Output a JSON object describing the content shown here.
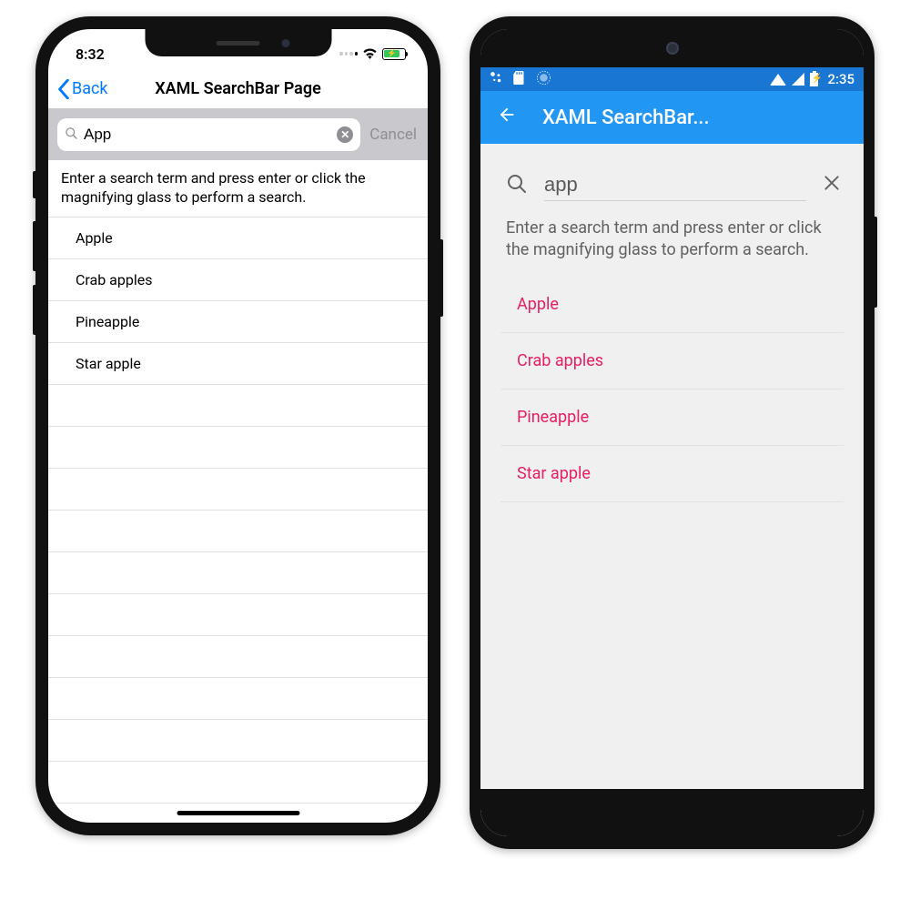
{
  "ios": {
    "status_time": "8:32",
    "back_label": "Back",
    "page_title": "XAML SearchBar Page",
    "search_value": "App",
    "cancel_label": "Cancel",
    "hint": "Enter a search term and press enter or click the magnifying glass to perform a search.",
    "results": [
      "Apple",
      "Crab apples",
      "Pineapple",
      "Star apple"
    ]
  },
  "android": {
    "status_time": "2:35",
    "page_title": "XAML SearchBar...",
    "search_value": "app",
    "hint": "Enter a search term and press enter or click the magnifying glass to perform a search.",
    "results": [
      "Apple",
      "Crab apples",
      "Pineapple",
      "Star apple"
    ]
  },
  "colors": {
    "android_accent": "#2196f3",
    "android_item": "#e91e63",
    "ios_accent": "#007aff"
  }
}
